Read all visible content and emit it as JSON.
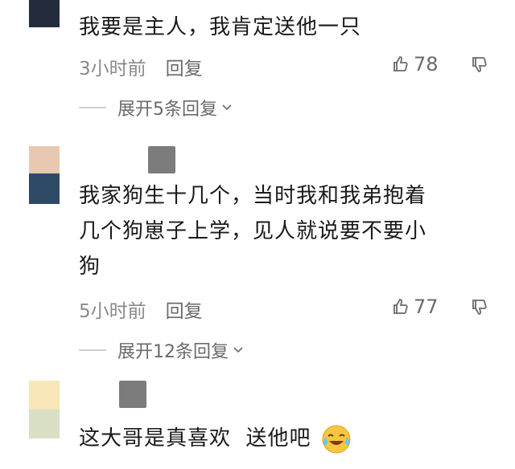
{
  "comments": [
    {
      "text": "我要是主人，我肯定送他一只",
      "time": "3小时前",
      "reply": "回复",
      "likes": "78",
      "expand": "展开5条回复",
      "avatar_colors": [
        "#222c3a"
      ]
    },
    {
      "text_lines": [
        "我家狗生十几个，当时我和我弟抱着",
        "几个狗崽子上学，见人就说要不要小",
        "狗"
      ],
      "time": "5小时前",
      "reply": "回复",
      "likes": "77",
      "expand": "展开12条回复",
      "avatar_colors": [
        "#e8c8b0",
        "#2f4a66"
      ]
    },
    {
      "text": "这大哥是真喜欢  送他吧",
      "emoji": "laughing-crying-emoji",
      "avatar_colors": [
        "#f8e6b8",
        "#d9dfc4"
      ]
    }
  ],
  "icons": {
    "like": "thumbs-up-icon",
    "dislike": "thumbs-down-icon",
    "chevron": "chevron-down-icon"
  }
}
